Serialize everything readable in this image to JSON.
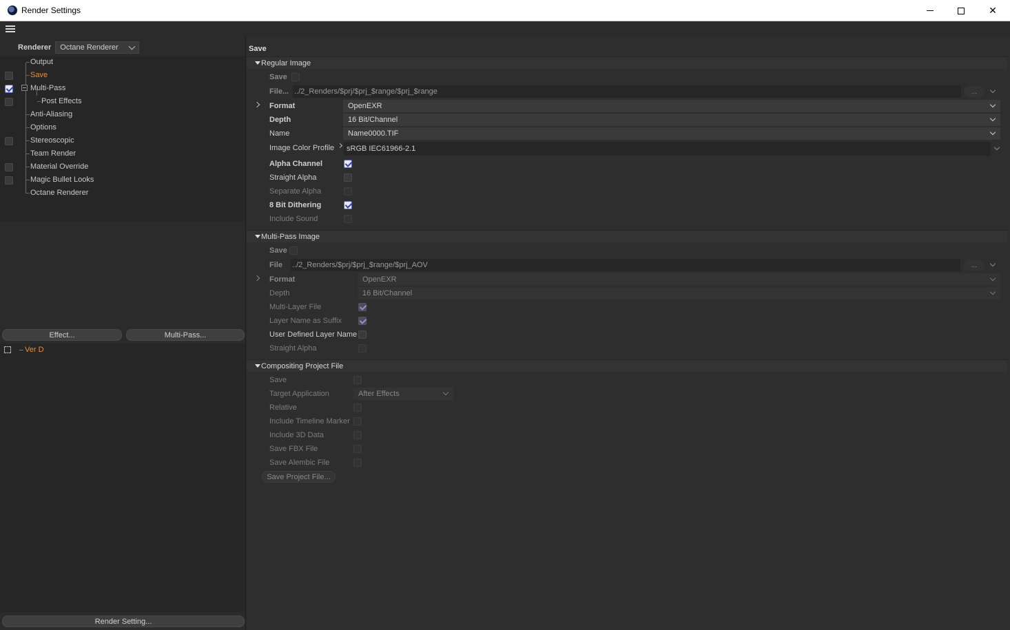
{
  "window": {
    "title": "Render Settings"
  },
  "left": {
    "renderer_label": "Renderer",
    "renderer_value": "Octane Renderer",
    "tree": [
      {
        "label": "Output",
        "checkbox": false,
        "checked": false,
        "active": false
      },
      {
        "label": "Save",
        "checkbox": true,
        "checked": false,
        "active": true
      },
      {
        "label": "Multi-Pass",
        "checkbox": true,
        "checked": true,
        "active": false
      },
      {
        "label": "Post Effects",
        "checkbox": true,
        "checked": false,
        "active": false
      },
      {
        "label": "Anti-Aliasing",
        "checkbox": false,
        "checked": false,
        "active": false
      },
      {
        "label": "Options",
        "checkbox": false,
        "checked": false,
        "active": false
      },
      {
        "label": "Stereoscopic",
        "checkbox": true,
        "checked": false,
        "active": false
      },
      {
        "label": "Team Render",
        "checkbox": false,
        "checked": false,
        "active": false
      },
      {
        "label": "Material Override",
        "checkbox": true,
        "checked": false,
        "active": false
      },
      {
        "label": "Magic Bullet Looks",
        "checkbox": true,
        "checked": false,
        "active": false
      },
      {
        "label": "Octane Renderer",
        "checkbox": false,
        "checked": false,
        "active": false
      }
    ],
    "effect_button": "Effect...",
    "multipass_button": "Multi-Pass...",
    "effect_items": [
      "Ver D"
    ],
    "render_setting_button": "Render Setting..."
  },
  "main": {
    "title": "Save",
    "regular": {
      "header": "Regular Image",
      "save_label": "Save",
      "file_label": "File...",
      "file_value": "../2_Renders/$prj/$prj_$range/$prj_$range",
      "browse": "...",
      "format_label": "Format",
      "format_value": "OpenEXR",
      "depth_label": "Depth",
      "depth_value": "16 Bit/Channel",
      "name_label": "Name",
      "name_value": "Name0000.TIF",
      "profile_label": "Image Color Profile",
      "profile_value": "sRGB IEC61966-2.1",
      "alpha_label": "Alpha Channel",
      "straight_label": "Straight Alpha",
      "separate_label": "Separate Alpha",
      "dither_label": "8 Bit Dithering",
      "sound_label": "Include Sound"
    },
    "multipass": {
      "header": "Multi-Pass Image",
      "save_label": "Save",
      "file_label": "File",
      "file_value": "../2_Renders/$prj/$prj_$range/$prj_AOV",
      "browse": "...",
      "format_label": "Format",
      "format_value": "OpenEXR",
      "depth_label": "Depth",
      "depth_value": "16 Bit/Channel",
      "multilayer_label": "Multi-Layer File",
      "suffix_label": "Layer Name as Suffix",
      "userdef_label": "User Defined Layer Name",
      "straight_label": "Straight Alpha"
    },
    "compositing": {
      "header": "Compositing Project File",
      "save_label": "Save",
      "target_label": "Target Application",
      "target_value": "After Effects",
      "relative_label": "Relative",
      "timeline_label": "Include Timeline Marker",
      "data3d_label": "Include 3D Data",
      "fbx_label": "Save FBX File",
      "alembic_label": "Save Alembic File",
      "save_project_button": "Save Project File..."
    }
  }
}
